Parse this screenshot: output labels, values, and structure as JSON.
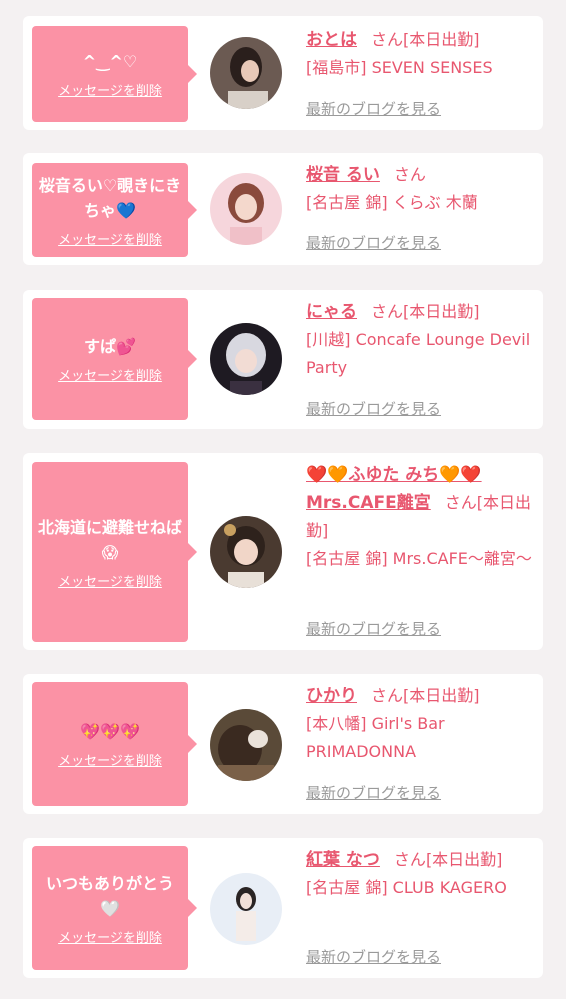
{
  "labels": {
    "delete": "メッセージを削除",
    "blog": "最新のブログを見る",
    "san": "さん",
    "working_suffix": "[本日出勤]"
  },
  "cards": [
    {
      "message": "^‿^♡",
      "name": "おとは",
      "working": true,
      "shop": "[福島市] SEVEN SENSES"
    },
    {
      "message": "桜音るい♡覗きにきちゃ💙",
      "name": "桜音 るい",
      "working": false,
      "shop": "[名古屋 錦] くらぶ 木蘭"
    },
    {
      "message": "すぱ💕",
      "name": "にゃる",
      "working": true,
      "shop": "[川越] Concafe Lounge Devil Party"
    },
    {
      "message": "北海道に避難せねば😱",
      "name": "❤️🧡ふゆた みち🧡❤️ Mrs.CAFE離宮",
      "working": true,
      "shop": "[名古屋 錦] Mrs.CAFE〜離宮〜"
    },
    {
      "message": "💖💖💖",
      "name": "ひかり",
      "working": true,
      "shop": "[本八幡] Girl's Bar PRIMADONNA"
    },
    {
      "message": "いつもありがとう🤍",
      "name": "紅葉 なつ",
      "working": true,
      "shop": "[名古屋 錦] CLUB KAGERO"
    }
  ],
  "colors": {
    "accent": "#e8576f",
    "bubble": "#fb92a5",
    "background": "#f4f1f2",
    "link_gray": "#9a9a9a"
  }
}
